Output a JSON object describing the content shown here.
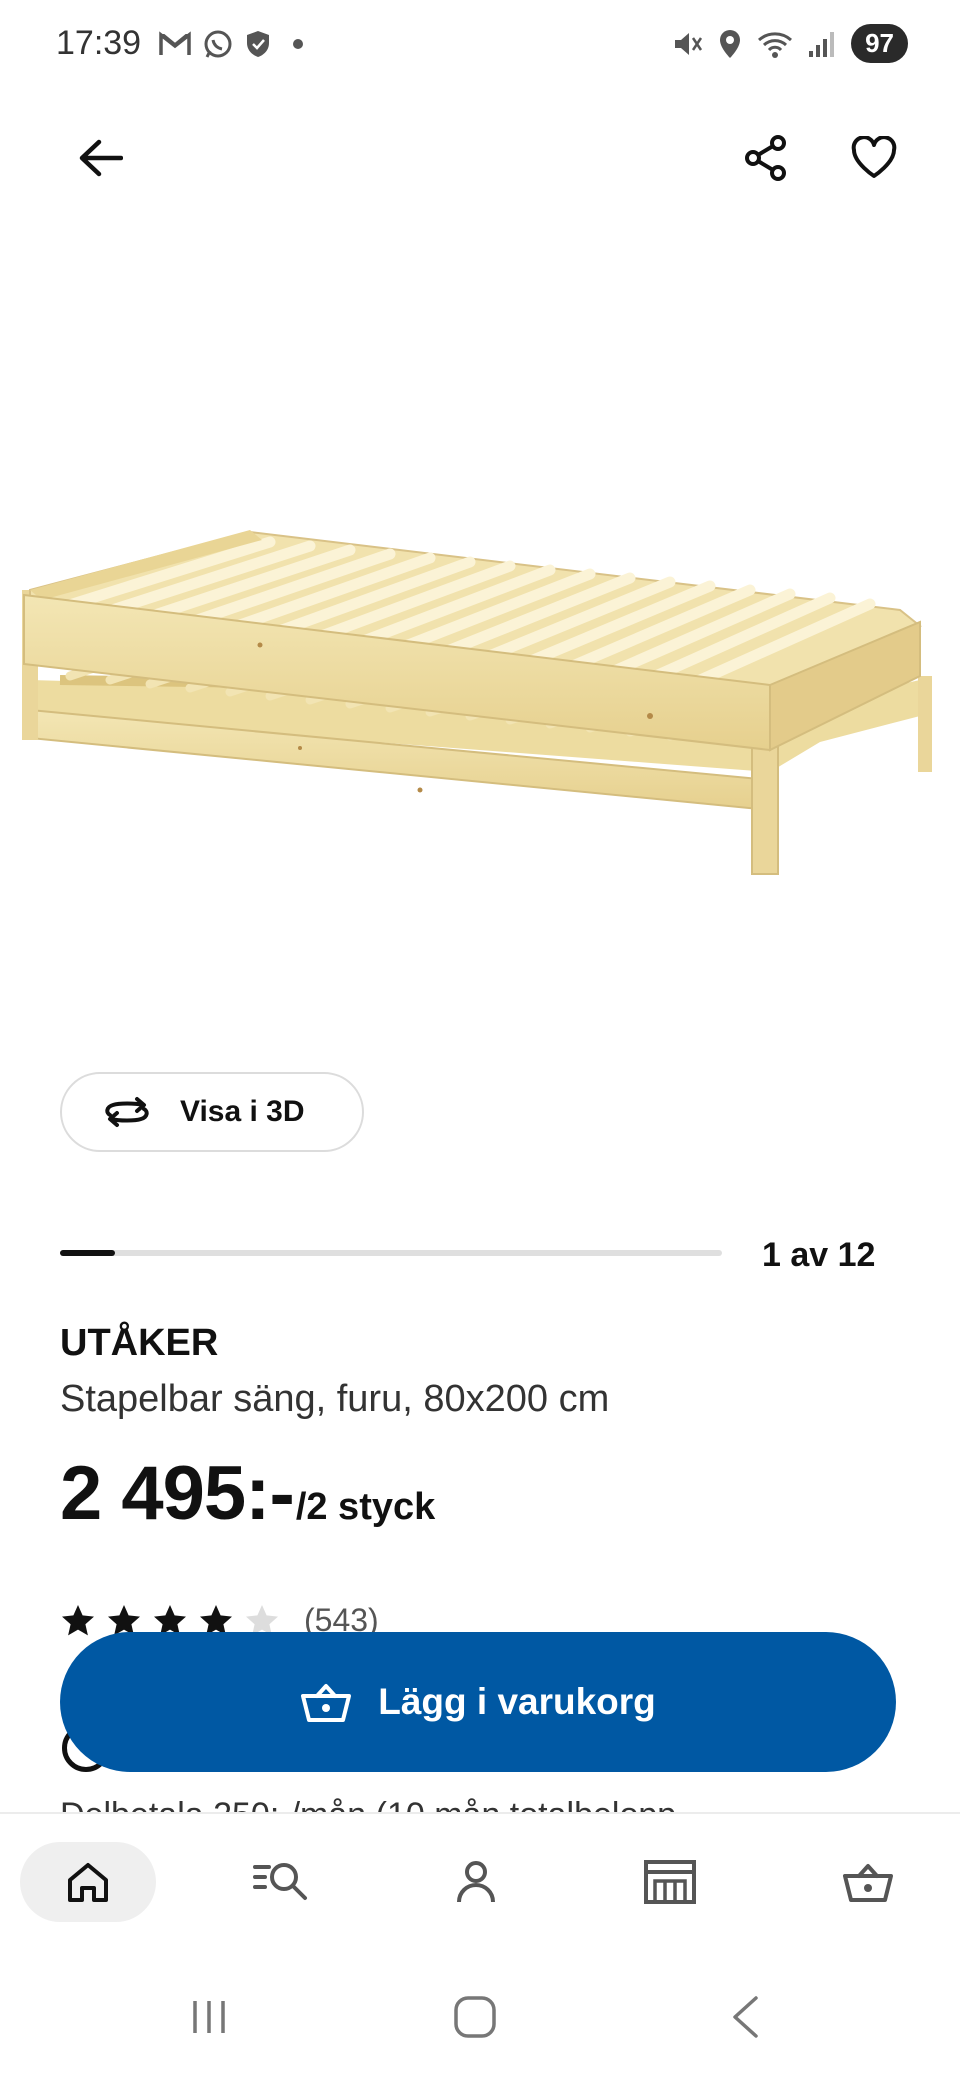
{
  "status_bar": {
    "time": "17:39",
    "battery": "97",
    "left_icons": [
      "gmail-icon",
      "whatsapp-icon",
      "shield-icon",
      "dot-icon"
    ],
    "right_icons": [
      "mute-icon",
      "location-icon",
      "wifi-icon",
      "signal-icon"
    ]
  },
  "nav": {
    "back_icon": "arrow-left-icon",
    "share_icon": "share-icon",
    "favorite_icon": "heart-icon"
  },
  "product": {
    "view_3d_label": "Visa i 3D",
    "carousel_label": "1 av 12",
    "carousel_current": 1,
    "carousel_total": 12,
    "name": "UTÅKER",
    "description": "Stapelbar säng, furu, 80x200 cm",
    "price": "2 495:-",
    "price_unit": "/2 styck",
    "rating_value": 4,
    "rating_max": 5,
    "rating_count": "(543)",
    "installment_text": "Delbetala 250:-/mån (10 mån totalbelopp"
  },
  "cart_button": {
    "label": "Lägg i varukorg",
    "color": "#0058a3"
  },
  "tabs": [
    {
      "name": "home",
      "icon": "home-icon",
      "active": true
    },
    {
      "name": "search",
      "icon": "search-icon",
      "active": false
    },
    {
      "name": "account",
      "icon": "person-icon",
      "active": false
    },
    {
      "name": "store",
      "icon": "store-icon",
      "active": false
    },
    {
      "name": "cart",
      "icon": "basket-icon",
      "active": false
    }
  ],
  "system_nav": [
    "recents-icon",
    "home-circle-icon",
    "back-chevron-icon"
  ]
}
